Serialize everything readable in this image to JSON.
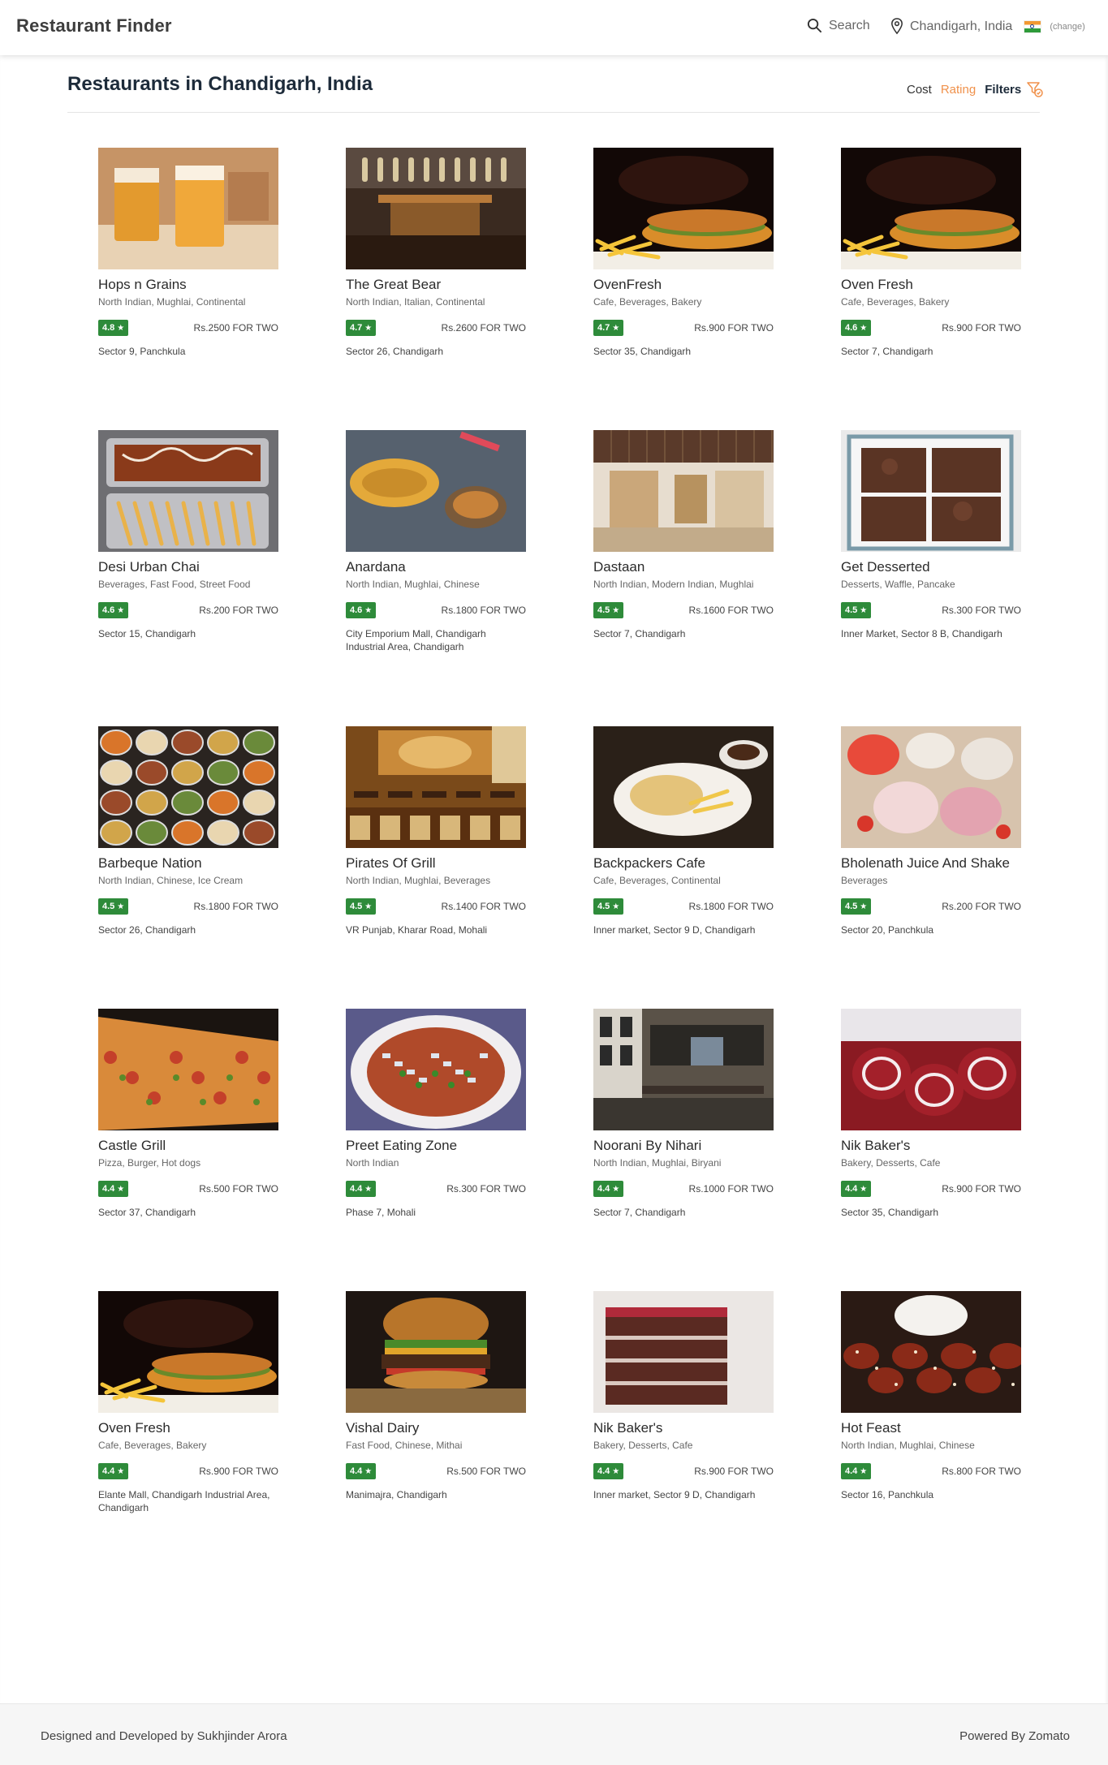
{
  "header": {
    "brand": "Restaurant Finder",
    "search_label": "Search",
    "location": "Chandigarh, India",
    "change_label": "(change)"
  },
  "page": {
    "title": "Restaurants in Chandigarh, India",
    "sort": {
      "cost": "Cost",
      "rating": "Rating",
      "filters": "Filters"
    },
    "accent_color": "#f0914b",
    "rating_color": "#2e8b3a"
  },
  "restaurants": [
    {
      "name": "Hops n Grains",
      "cuisine": "North Indian, Mughlai, Continental",
      "rating": "4.8",
      "price": "Rs.2500 FOR TWO",
      "address": "Sector 9, Panchkula",
      "image": "beer-glasses"
    },
    {
      "name": "The Great Bear",
      "cuisine": "North Indian, Italian, Continental",
      "rating": "4.7",
      "price": "Rs.2600 FOR TWO",
      "address": "Sector 26, Chandigarh",
      "image": "bar-counter"
    },
    {
      "name": "OvenFresh",
      "cuisine": "Cafe, Beverages, Bakery",
      "rating": "4.7",
      "price": "Rs.900 FOR TWO",
      "address": "Sector 35, Chandigarh",
      "image": "sandwich-fries"
    },
    {
      "name": "Oven Fresh",
      "cuisine": "Cafe, Beverages, Bakery",
      "rating": "4.6",
      "price": "Rs.900 FOR TWO",
      "address": "Sector 7, Chandigarh",
      "image": "sandwich-fries"
    },
    {
      "name": "Desi Urban Chai",
      "cuisine": "Beverages, Fast Food, Street Food",
      "rating": "4.6",
      "price": "Rs.200 FOR TWO",
      "address": "Sector 15, Chandigarh",
      "image": "fries-trays"
    },
    {
      "name": "Anardana",
      "cuisine": "North Indian, Mughlai, Chinese",
      "rating": "4.6",
      "price": "Rs.1800 FOR TWO",
      "address": "City Emporium Mall, Chandigarh Industrial Area, Chandigarh",
      "image": "curry-plate"
    },
    {
      "name": "Dastaan",
      "cuisine": "North Indian, Modern Indian, Mughlai",
      "rating": "4.5",
      "price": "Rs.1600 FOR TWO",
      "address": "Sector 7, Chandigarh",
      "image": "restaurant-interior"
    },
    {
      "name": "Get Desserted",
      "cuisine": "Desserts, Waffle, Pancake",
      "rating": "4.5",
      "price": "Rs.300 FOR TWO",
      "address": "Inner Market, Sector 8 B, Chandigarh",
      "image": "brownie-box"
    },
    {
      "name": "Barbeque Nation",
      "cuisine": "North Indian, Chinese, Ice Cream",
      "rating": "4.5",
      "price": "Rs.1800 FOR TWO",
      "address": "Sector 26, Chandigarh",
      "image": "buffet-platter"
    },
    {
      "name": "Pirates Of Grill",
      "cuisine": "North Indian, Mughlai, Beverages",
      "rating": "4.5",
      "price": "Rs.1400 FOR TWO",
      "address": "VR Punjab, Kharar Road, Mohali",
      "image": "grill-interior"
    },
    {
      "name": "Backpackers Cafe",
      "cuisine": "Cafe, Beverages, Continental",
      "rating": "4.5",
      "price": "Rs.1800 FOR TWO",
      "address": "Inner market, Sector 9 D, Chandigarh",
      "image": "cafe-plate"
    },
    {
      "name": "Bholenath Juice And Shake",
      "cuisine": "Beverages",
      "rating": "4.5",
      "price": "Rs.200 FOR TWO",
      "address": "Sector 20, Panchkula",
      "image": "shakes-bowls"
    },
    {
      "name": "Castle Grill",
      "cuisine": "Pizza, Burger, Hot dogs",
      "rating": "4.4",
      "price": "Rs.500 FOR TWO",
      "address": "Sector 37, Chandigarh",
      "image": "pizza-slice"
    },
    {
      "name": "Preet Eating Zone",
      "cuisine": "North Indian",
      "rating": "4.4",
      "price": "Rs.300 FOR TWO",
      "address": "Phase 7, Mohali",
      "image": "chaat-plate"
    },
    {
      "name": "Noorani By Nihari",
      "cuisine": "North Indian, Mughlai, Biryani",
      "rating": "4.4",
      "price": "Rs.1000 FOR TWO",
      "address": "Sector 7, Chandigarh",
      "image": "dining-room"
    },
    {
      "name": "Nik Baker's",
      "cuisine": "Bakery, Desserts, Cafe",
      "rating": "4.4",
      "price": "Rs.900 FOR TWO",
      "address": "Sector 35, Chandigarh",
      "image": "red-velvet-rolls"
    },
    {
      "name": "Oven Fresh",
      "cuisine": "Cafe, Beverages, Bakery",
      "rating": "4.4",
      "price": "Rs.900 FOR TWO",
      "address": "Elante Mall, Chandigarh Industrial Area, Chandigarh",
      "image": "sandwich-fries"
    },
    {
      "name": "Vishal Dairy",
      "cuisine": "Fast Food, Chinese, Mithai",
      "rating": "4.4",
      "price": "Rs.500 FOR TWO",
      "address": "Manimajra, Chandigarh",
      "image": "burger"
    },
    {
      "name": "Nik Baker's",
      "cuisine": "Bakery, Desserts, Cafe",
      "rating": "4.4",
      "price": "Rs.900 FOR TWO",
      "address": "Inner market, Sector 9 D, Chandigarh",
      "image": "cake-slice"
    },
    {
      "name": "Hot Feast",
      "cuisine": "North Indian, Mughlai, Chinese",
      "rating": "4.4",
      "price": "Rs.800 FOR TWO",
      "address": "Sector 16, Panchkula",
      "image": "chicken-wings"
    }
  ],
  "footer": {
    "credit": "Designed and Developed by Sukhjinder Arora",
    "powered": "Powered By Zomato"
  }
}
